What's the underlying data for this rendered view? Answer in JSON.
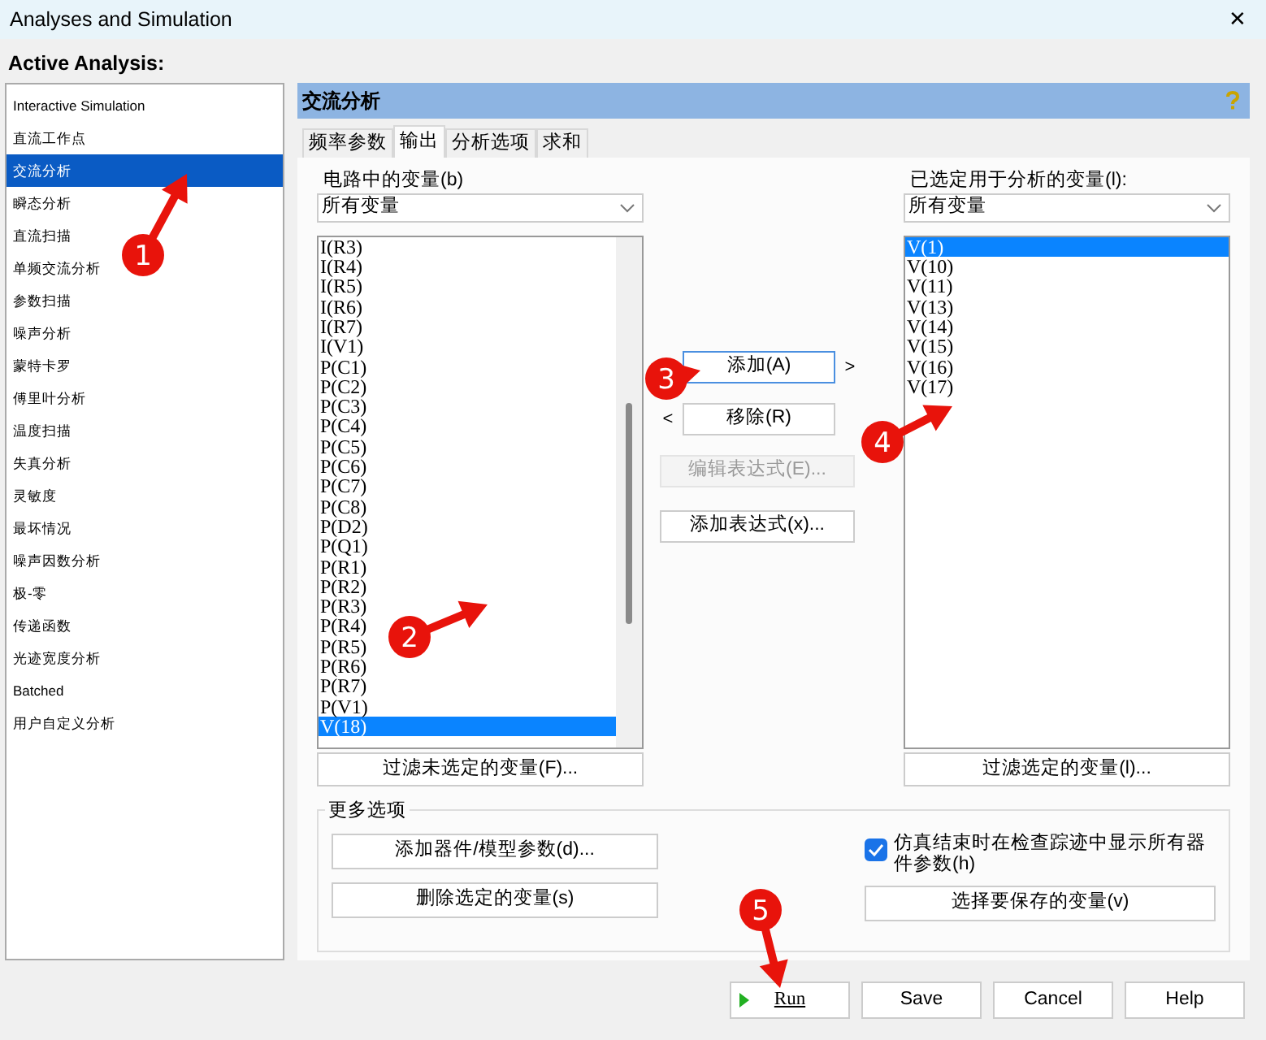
{
  "window": {
    "title": "Analyses and Simulation",
    "close": "✕"
  },
  "sidebar": {
    "title": "Active Analysis:",
    "items": [
      {
        "label": "Interactive Simulation",
        "selected": false
      },
      {
        "label": "直流工作点",
        "selected": false
      },
      {
        "label": "交流分析",
        "selected": true
      },
      {
        "label": "瞬态分析",
        "selected": false
      },
      {
        "label": "直流扫描",
        "selected": false
      },
      {
        "label": "单频交流分析",
        "selected": false
      },
      {
        "label": "参数扫描",
        "selected": false
      },
      {
        "label": "噪声分析",
        "selected": false
      },
      {
        "label": "蒙特卡罗",
        "selected": false
      },
      {
        "label": "傅里叶分析",
        "selected": false
      },
      {
        "label": "温度扫描",
        "selected": false
      },
      {
        "label": "失真分析",
        "selected": false
      },
      {
        "label": "灵敏度",
        "selected": false
      },
      {
        "label": "最坏情况",
        "selected": false
      },
      {
        "label": "噪声因数分析",
        "selected": false
      },
      {
        "label": "极-零",
        "selected": false
      },
      {
        "label": "传递函数",
        "selected": false
      },
      {
        "label": "光迹宽度分析",
        "selected": false
      },
      {
        "label": "Batched",
        "selected": false
      },
      {
        "label": "用户自定义分析",
        "selected": false
      }
    ]
  },
  "panel": {
    "title": "交流分析"
  },
  "tabs": [
    {
      "label": "频率参数",
      "selected": false
    },
    {
      "label": "输出",
      "selected": true
    },
    {
      "label": "分析选项",
      "selected": false
    },
    {
      "label": "求和",
      "selected": false
    }
  ],
  "circuit_variables": {
    "label": "电路中的变量(b)",
    "filter": "所有变量",
    "items": [
      {
        "label": "I(R3)",
        "selected": false
      },
      {
        "label": "I(R4)",
        "selected": false
      },
      {
        "label": "I(R5)",
        "selected": false
      },
      {
        "label": "I(R6)",
        "selected": false
      },
      {
        "label": "I(R7)",
        "selected": false
      },
      {
        "label": "I(V1)",
        "selected": false
      },
      {
        "label": "P(C1)",
        "selected": false
      },
      {
        "label": "P(C2)",
        "selected": false
      },
      {
        "label": "P(C3)",
        "selected": false
      },
      {
        "label": "P(C4)",
        "selected": false
      },
      {
        "label": "P(C5)",
        "selected": false
      },
      {
        "label": "P(C6)",
        "selected": false
      },
      {
        "label": "P(C7)",
        "selected": false
      },
      {
        "label": "P(C8)",
        "selected": false
      },
      {
        "label": "P(D2)",
        "selected": false
      },
      {
        "label": "P(Q1)",
        "selected": false
      },
      {
        "label": "P(R1)",
        "selected": false
      },
      {
        "label": "P(R2)",
        "selected": false
      },
      {
        "label": "P(R3)",
        "selected": false
      },
      {
        "label": "P(R4)",
        "selected": false
      },
      {
        "label": "P(R5)",
        "selected": false
      },
      {
        "label": "P(R6)",
        "selected": false
      },
      {
        "label": "P(R7)",
        "selected": false
      },
      {
        "label": "P(V1)",
        "selected": false
      },
      {
        "label": "V(18)",
        "selected": true
      }
    ],
    "button": "过滤未选定的变量(F)..."
  },
  "middle_buttons": [
    {
      "label": "添加(A)",
      "arrow": ">",
      "focused": true,
      "disabled": false
    },
    {
      "label": "移除(R)",
      "arrow": "<",
      "focused": false,
      "disabled": false
    },
    {
      "label": "编辑表达式(E)...",
      "focused": false,
      "disabled": true
    },
    {
      "label": "添加表达式(x)...",
      "focused": false,
      "disabled": false
    }
  ],
  "selected_variables": {
    "label": "已选定用于分析的变量(l):",
    "filter": "所有变量",
    "items": [
      {
        "label": "V(1)",
        "selected": true
      },
      {
        "label": "V(10)",
        "selected": false
      },
      {
        "label": "V(11)",
        "selected": false
      },
      {
        "label": "V(13)",
        "selected": false
      },
      {
        "label": "V(14)",
        "selected": false
      },
      {
        "label": "V(15)",
        "selected": false
      },
      {
        "label": "V(16)",
        "selected": false
      },
      {
        "label": "V(17)",
        "selected": false
      }
    ],
    "button": "过滤选定的变量(l)..."
  },
  "more_options": {
    "title": "更多选项",
    "buttons": [
      "添加器件/模型参数(d)...",
      "删除选定的变量(s)"
    ],
    "checkbox": {
      "label": "仿真结束时在检查踪迹中显示所有器件参数(h)",
      "checked": true
    },
    "save_button": "选择要保存的变量(v)"
  },
  "footer": [
    {
      "label": "Run",
      "kind": "run"
    },
    {
      "label": "Save",
      "kind": "plain"
    },
    {
      "label": "Cancel",
      "kind": "plain"
    },
    {
      "label": "Help",
      "kind": "plain"
    }
  ],
  "annotations": [
    {
      "label": "1"
    },
    {
      "label": "2"
    },
    {
      "label": "3"
    },
    {
      "label": "4"
    },
    {
      "label": "5"
    }
  ]
}
